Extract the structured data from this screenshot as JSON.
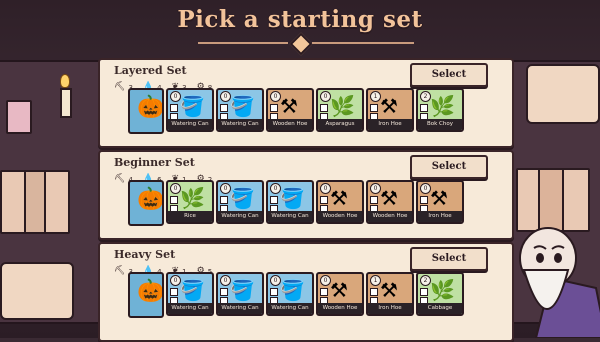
{
  "title": "Pick a starting set",
  "stat_icons": [
    "pick-icon",
    "drop-icon",
    "leaf-icon",
    "gear-icon"
  ],
  "sets": [
    {
      "name": "Layered Set",
      "select_label": "Select",
      "stats": [
        "3",
        "4",
        "3",
        "8"
      ],
      "hero": "scarecrow",
      "cards": [
        {
          "num": "0",
          "label": "Watering Can",
          "kind": "blue"
        },
        {
          "num": "0",
          "label": "Watering Can",
          "kind": "blue"
        },
        {
          "num": "0",
          "label": "Wooden Hoe",
          "kind": "orange"
        },
        {
          "num": "0",
          "label": "Asparagus",
          "kind": "green"
        },
        {
          "num": "1",
          "label": "Iron Hoe",
          "kind": "orange"
        },
        {
          "num": "2",
          "label": "Bok Choy",
          "kind": "green"
        }
      ]
    },
    {
      "name": "Beginner Set",
      "select_label": "Select",
      "stats": [
        "4",
        "6",
        "1",
        "2"
      ],
      "hero": "scarecrow",
      "cards": [
        {
          "num": "0",
          "label": "Rice",
          "kind": "green"
        },
        {
          "num": "0",
          "label": "Watering Can",
          "kind": "blue"
        },
        {
          "num": "0",
          "label": "Watering Can",
          "kind": "blue"
        },
        {
          "num": "0",
          "label": "Wooden Hoe",
          "kind": "orange"
        },
        {
          "num": "0",
          "label": "Wooden Hoe",
          "kind": "orange"
        },
        {
          "num": "0",
          "label": "Iron Hoe",
          "kind": "orange"
        }
      ]
    },
    {
      "name": "Heavy Set",
      "select_label": "Select",
      "stats": [
        "3",
        "4",
        "1",
        "5"
      ],
      "hero": "scarecrow",
      "cards": [
        {
          "num": "0",
          "label": "Watering Can",
          "kind": "blue"
        },
        {
          "num": "0",
          "label": "Watering Can",
          "kind": "blue"
        },
        {
          "num": "0",
          "label": "Watering Can",
          "kind": "blue"
        },
        {
          "num": "0",
          "label": "Wooden Hoe",
          "kind": "orange"
        },
        {
          "num": "1",
          "label": "Iron Hoe",
          "kind": "orange"
        },
        {
          "num": "2",
          "label": "Cabbage",
          "kind": "green"
        }
      ]
    }
  ]
}
